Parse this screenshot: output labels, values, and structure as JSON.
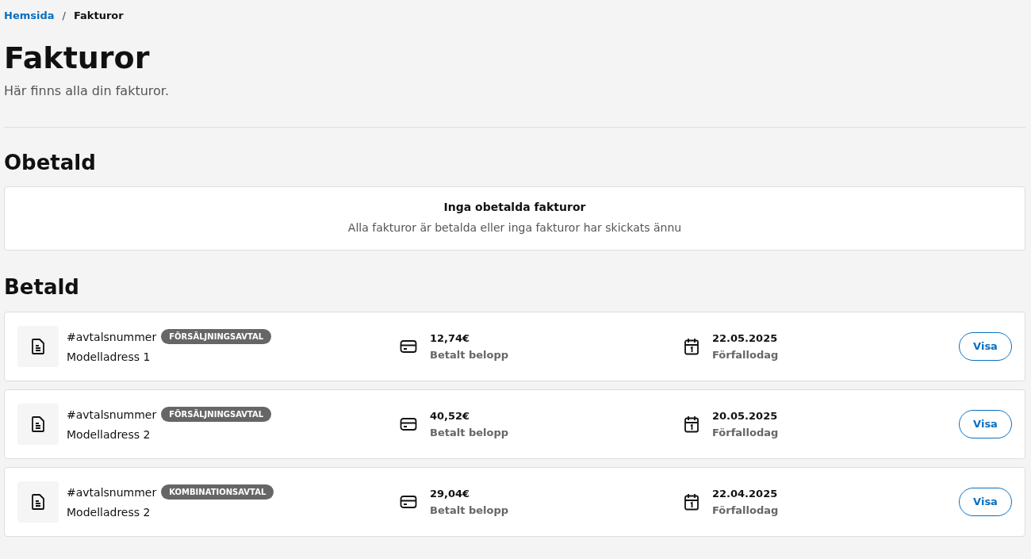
{
  "breadcrumb": [
    {
      "label": "Hemsida",
      "kind": "link"
    },
    {
      "label": "Fakturor",
      "kind": "current"
    }
  ],
  "breadcrumb_separator": "/",
  "title": "Fakturor",
  "subtitle": "Här finns alla din fakturor.",
  "sections": [
    {
      "heading": "Obetald",
      "empty": {
        "title": "Inga obetalda fakturor",
        "text": "Alla fakturor är betalda eller inga fakturor har skickats ännu"
      }
    },
    {
      "heading": "Betald",
      "invoices": [
        {
          "number": "#avtalsnummer",
          "tag": "FÖRSÄLJNINGSAVTAL",
          "address": "Modelladress 1",
          "amount": "12,74€",
          "amount_label": "Betalt belopp",
          "date": "22.05.2025",
          "date_label": "Förfallodag",
          "button": "Visa"
        },
        {
          "number": "#avtalsnummer",
          "tag": "FÖRSÄLJNINGSAVTAL",
          "address": "Modelladress 2",
          "amount": "40,52€",
          "amount_label": "Betalt belopp",
          "date": "20.05.2025",
          "date_label": "Förfallodag",
          "button": "Visa"
        },
        {
          "number": "#avtalsnummer",
          "tag": "KOMBINATIONSAVTAL",
          "address": "Modelladress 2",
          "amount": "29,04€",
          "amount_label": "Betalt belopp",
          "date": "22.04.2025",
          "date_label": "Förfallodag",
          "button": "Visa"
        }
      ]
    }
  ]
}
